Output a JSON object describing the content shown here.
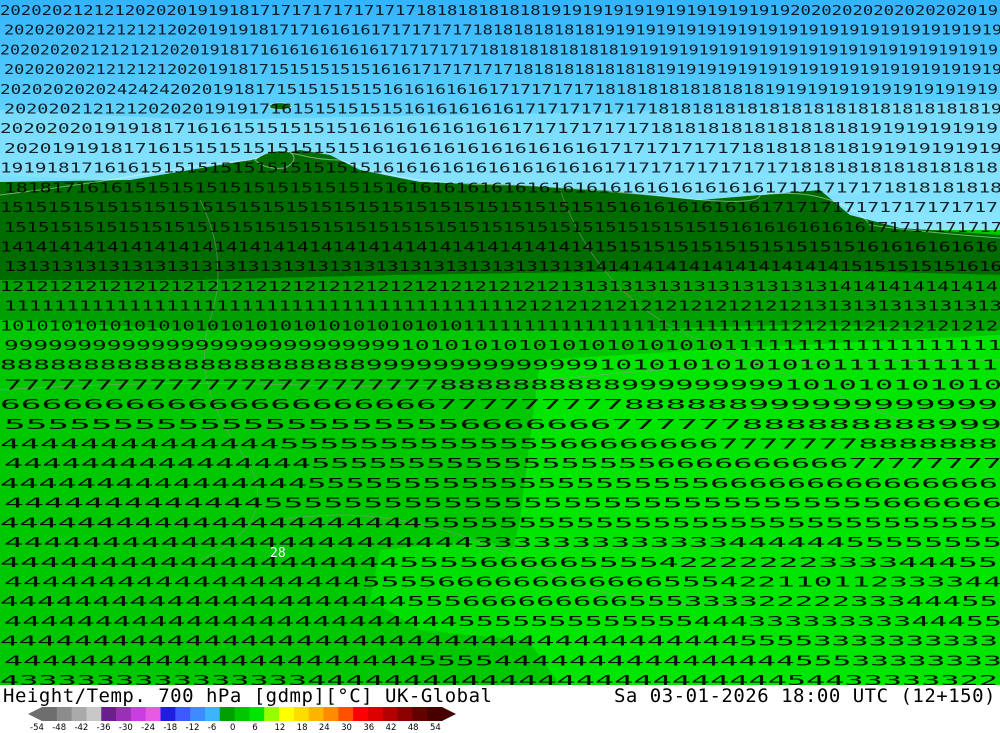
{
  "map": {
    "product": "Height/Temp. 700 hPa [gdmp][°C] UK-Global",
    "valid_time": "Sa 03-01-2026 18:00 UTC (12+150)",
    "colors": {
      "cold_deep": "#33b4ff",
      "cold": "#5fd2ff",
      "cold_light": "#8ee6ff",
      "mild_dark": "#006c00",
      "mild_mid": "#00a000",
      "mild": "#00c800",
      "mild_bright": "#00e600"
    },
    "contour_label_rows": [
      "202020212121202020191918171717171717171718181818181819191919191919191919191920202020202020202019",
      "20202020212121212020191918171716161617171717171818181818181919191919191919191919191919191919191919",
      "2020202021212121202019181716161616161617171717171818181818181819191919191919191919191919191919191919",
      "20202020212121212020191817151515151516161717171717181818181818181919191919191919191919191919191919",
      "2020202020242424202019181715151515151616161616171717171718181818181818181919191919191919191919",
      "202020212121202020191917161515151515161616161617171717171718181818181818181818181818181819",
      "20202020191918171616151515151516161616161616171717171717181818181818181818191919191919",
      "202019191817161515151515151515161616161616161616161717171717171818181818191919191919",
      "19191817161615151515151515151515161616161616161616161717171717171717181818181818181818",
      "181817161615151515151515151515151616161616161616161616161616161617171717171818181818",
      "151515151515151515151515151515151515151515151515151516161616161617171717171717171717",
      "1515151515151515151515151515151515151515151515151515151515151515161616161616171717171717",
      "141414141414141414141414141414141414141414141414141515151515151515151515161616161616",
      "13131313131313131313131313131313131313131313131313141414141414141414141415151515151616",
      "1212121212121212121212121212121212121212121212131313131313131313131314141414141414",
      "11111111111111111111111111111111111111111212121212121212121212121313131313131313",
      "1010101010101010101010101010101010101011111111111111111111111111121212121212121212",
      "99999999999999999999999999910101010101010101010101111111111111111111",
      "888888888888888888888899999999999999101010101010101111111111",
      "7777777777777777777777778888888888999999999101010101010",
      "666666666666666666666777777777888888999999999999",
      "5555555555555555555556666666777777888888888999",
      "44444444444444555555555555556666666677777778888888",
      "4444444444444444555555555555555555666666666677777777",
      "4444444444444444555555555555555555555666666666666666",
      "44444444444445555555555555555555555555555555666666",
      "4444444444444444444444555555555555555555555555555555",
      "444444444444444444444444333333333333344444455555555",
      "44444444444444444444555566666555542222222333344455",
      "44444444444444444445555666666666666555422110112333344",
      "444444444444444444444455566666666655533332222233344455",
      "4444444444444444444444444555555555555544433333333344455",
      "444444444444444444444444444444444444444455553333333333",
      "44444444444444444444445555444444444444444455533333333",
      "4333333333333333444444444444444444444444454433333322"
    ],
    "station_label": "28"
  },
  "footer": {
    "title_left": "Height/Temp. 700 hPa [gdmp][°C] UK-Global",
    "title_right": "Sa 03-01-2026 18:00 UTC (12+150)",
    "colorbar_ticks": [
      "-54",
      "-48",
      "-42",
      "-36",
      "-30",
      "-24",
      "-18",
      "-12",
      "-6",
      "0",
      "6",
      "12",
      "18",
      "24",
      "30",
      "36",
      "42",
      "48",
      "54"
    ],
    "colorbar_colors": [
      "#6e6e6e",
      "#8c8c8c",
      "#aaaaaa",
      "#c8c8c8",
      "#6b1f8c",
      "#9b2fb8",
      "#c83ee0",
      "#e65ae6",
      "#1e1edc",
      "#3c5aff",
      "#3c8cff",
      "#3cb4ff",
      "#00a000",
      "#00c800",
      "#00e600",
      "#96ff00",
      "#ffff00",
      "#ffdc00",
      "#ffb400",
      "#ff8c00",
      "#ff5000",
      "#ff0000",
      "#dc0000",
      "#b40000",
      "#8c0000",
      "#640000",
      "#460000"
    ]
  }
}
